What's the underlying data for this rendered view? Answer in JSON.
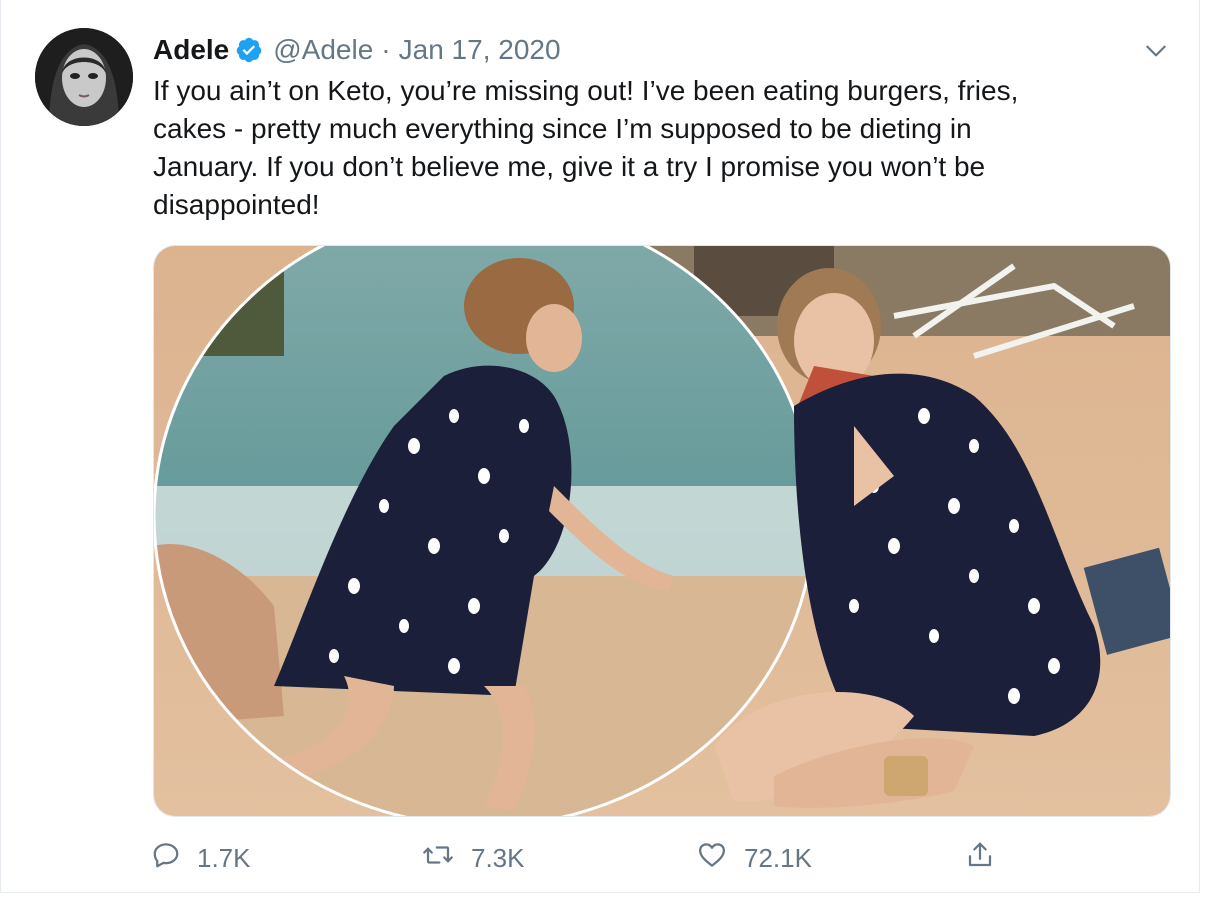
{
  "tweet": {
    "author_name": "Adele",
    "handle": "@Adele",
    "separator": "·",
    "date": "Jan 17, 2020",
    "verified": true,
    "text_lines": [
      "If you ain’t on Keto, you’re missing out! I’ve been eating burgers, fries,",
      "cakes - pretty much everything since I’m supposed to be dieting in",
      "January. If you don’t believe me, give it a try I promise you won’t be",
      "disappointed!"
    ]
  },
  "actions": {
    "reply_count": "1.7K",
    "retweet_count": "7.3K",
    "like_count": "72.1K"
  },
  "icons": {
    "verified": "verified-badge-icon",
    "menu": "chevron-down-icon",
    "reply": "reply-icon",
    "retweet": "retweet-icon",
    "like": "heart-icon",
    "share": "share-icon"
  },
  "colors": {
    "text_primary": "#14171a",
    "text_secondary": "#657786",
    "verified_blue": "#1da1f2",
    "border": "#e6ecf0"
  }
}
